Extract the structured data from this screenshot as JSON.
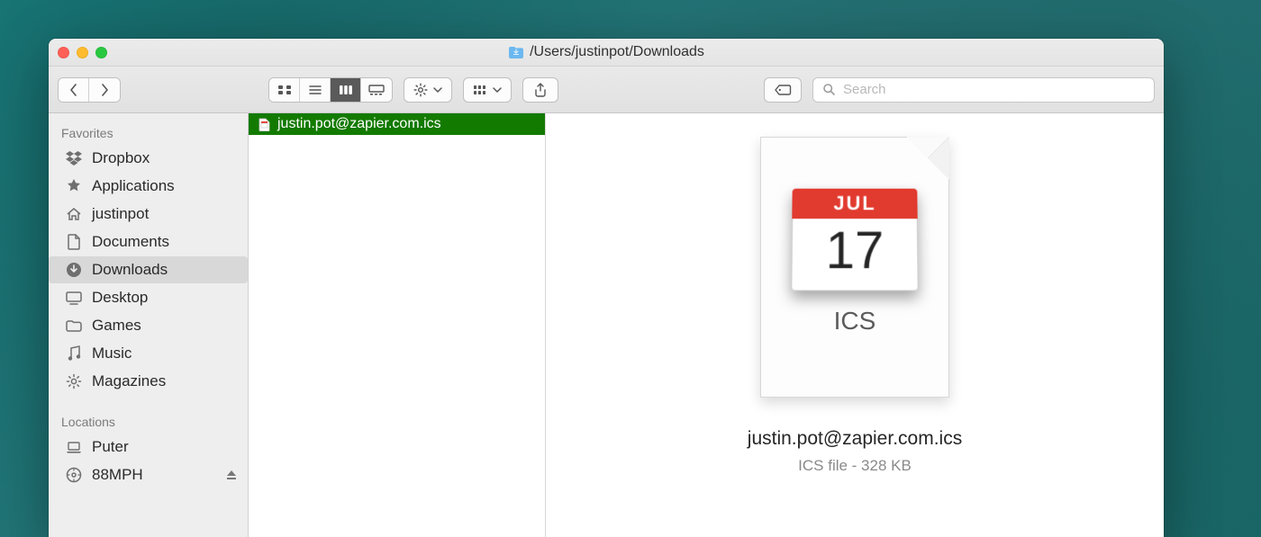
{
  "title": {
    "path": "/Users/justinpot/Downloads",
    "folder_icon": "download-folder-icon"
  },
  "toolbar": {
    "search_placeholder": "Search"
  },
  "sidebar": {
    "sections": [
      {
        "label": "Favorites"
      },
      {
        "label": "Locations"
      }
    ],
    "favorites": [
      {
        "icon": "dropbox-icon",
        "label": "Dropbox"
      },
      {
        "icon": "app-icon",
        "label": "Applications"
      },
      {
        "icon": "home-icon",
        "label": "justinpot"
      },
      {
        "icon": "document-icon",
        "label": "Documents"
      },
      {
        "icon": "download-icon",
        "label": "Downloads",
        "selected": true
      },
      {
        "icon": "desktop-icon",
        "label": "Desktop"
      },
      {
        "icon": "folder-icon",
        "label": "Games"
      },
      {
        "icon": "music-icon",
        "label": "Music"
      },
      {
        "icon": "gear-icon",
        "label": "Magazines"
      }
    ],
    "locations": [
      {
        "icon": "laptop-icon",
        "label": "Puter"
      },
      {
        "icon": "disk-icon",
        "label": "88MPH",
        "ejectable": true
      }
    ]
  },
  "files": [
    {
      "name": "justin.pot@zapier.com.ics",
      "selected": true,
      "icon": "ics-doc-icon"
    }
  ],
  "preview": {
    "cal_month": "JUL",
    "cal_day": "17",
    "type_label": "ICS",
    "filename": "justin.pot@zapier.com.ics",
    "meta": "ICS file - 328 KB"
  }
}
